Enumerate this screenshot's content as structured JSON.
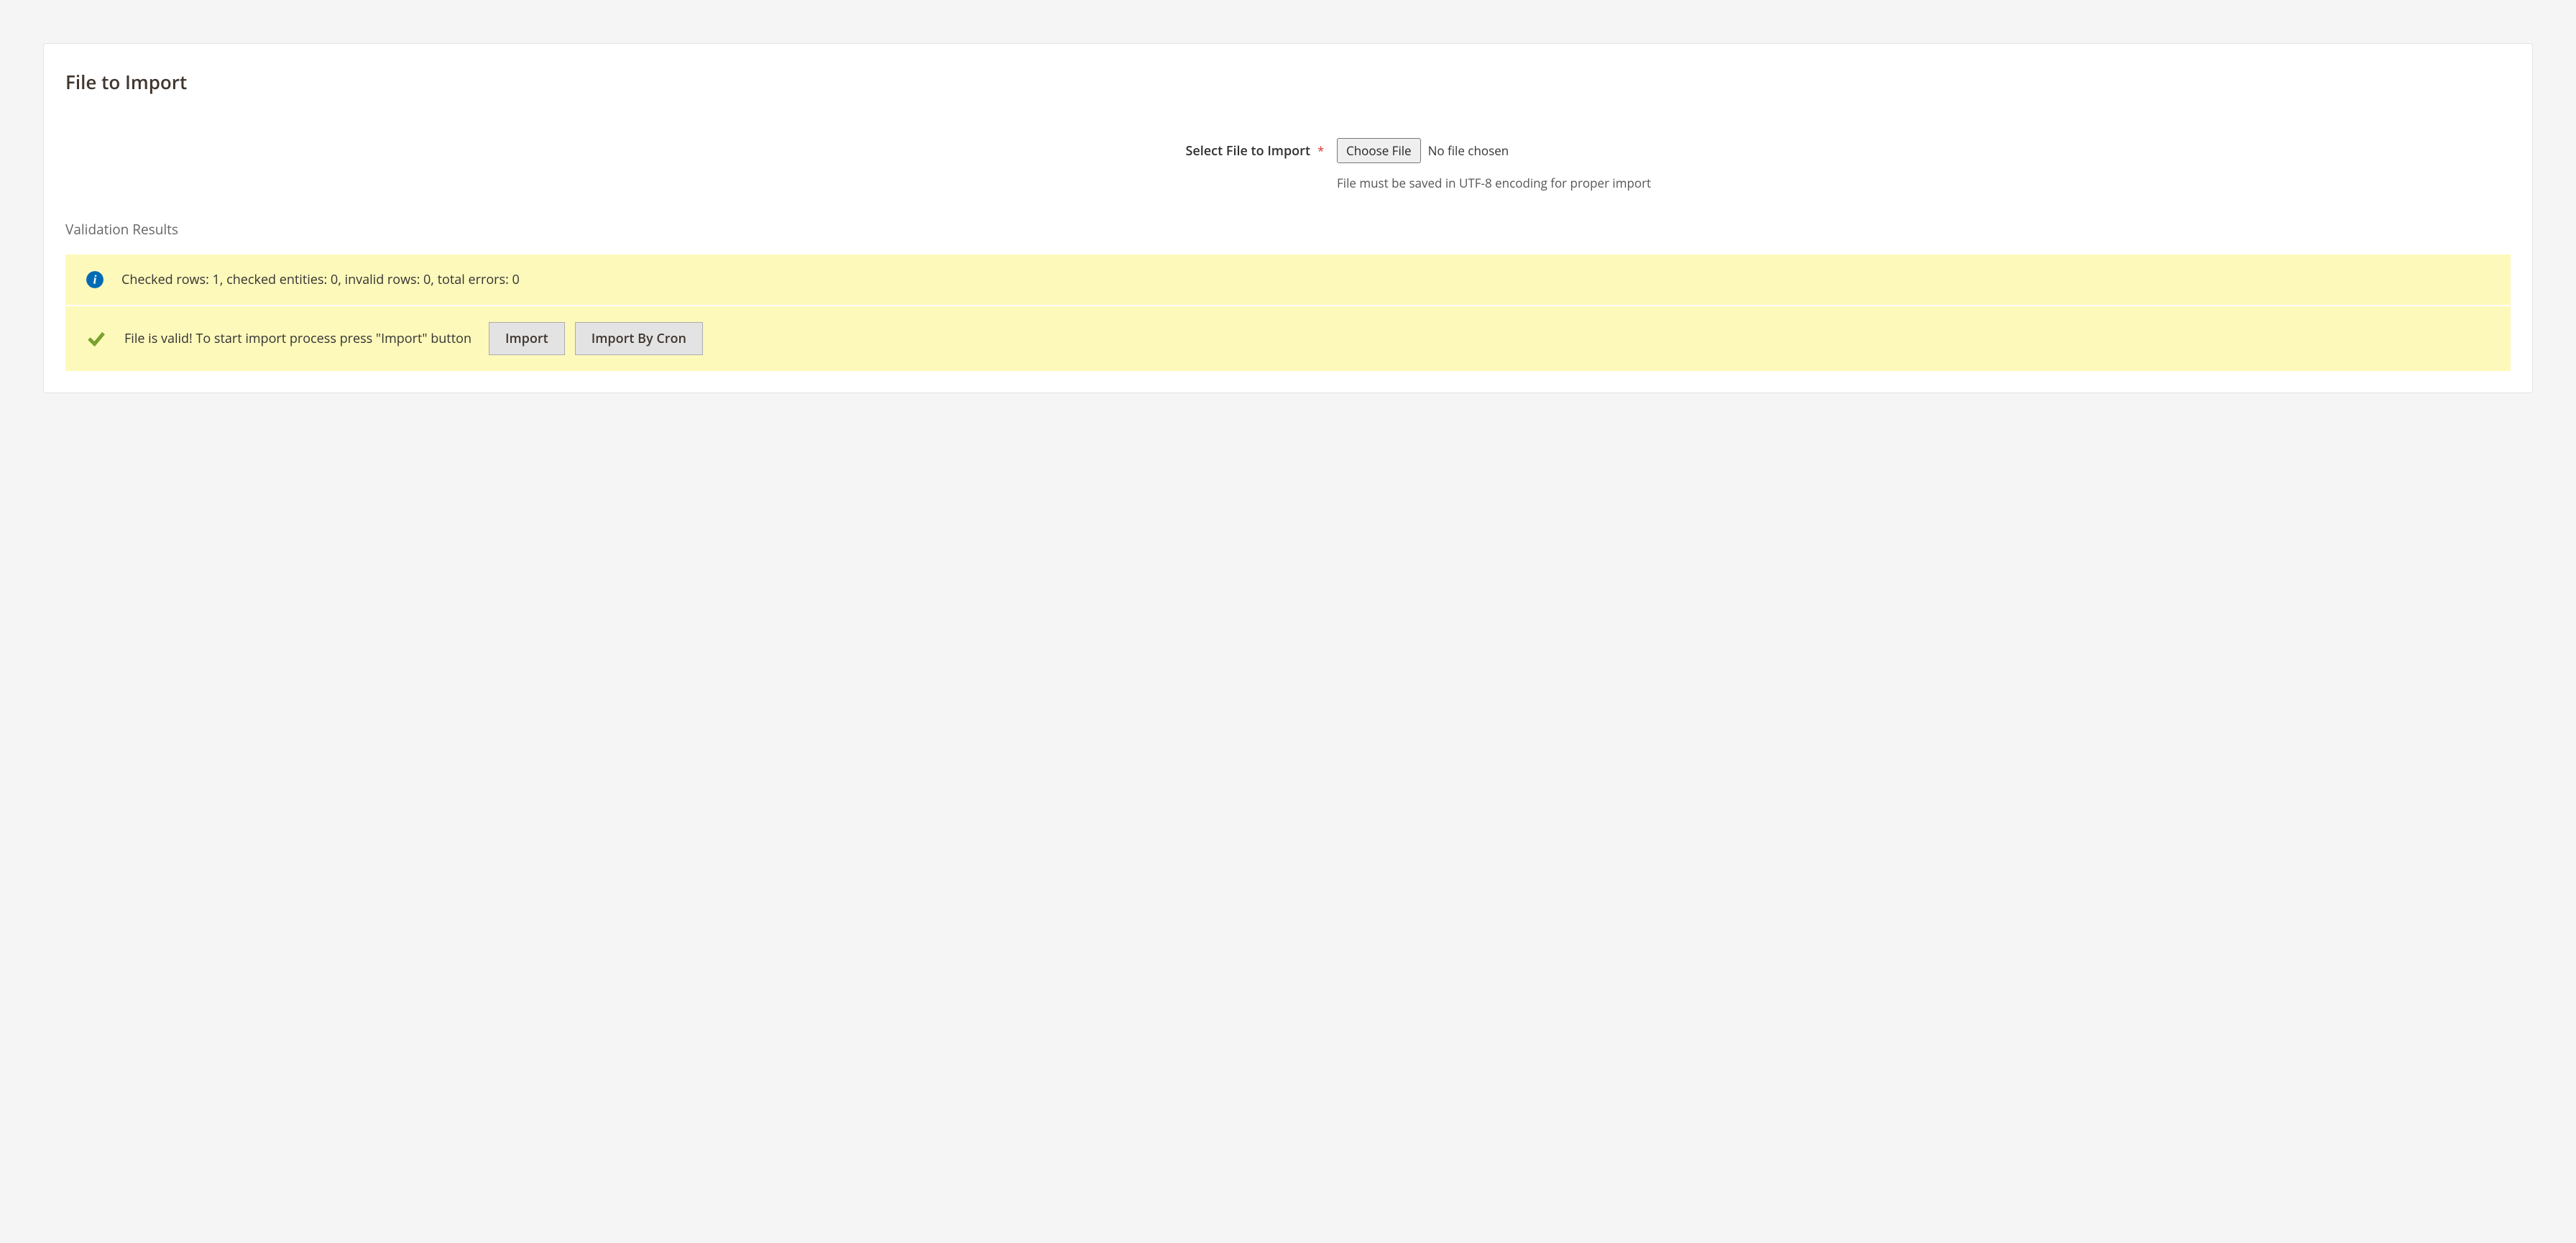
{
  "panel": {
    "title": "File to Import",
    "fileField": {
      "label": "Select File to Import",
      "requiredMark": "*",
      "chooseButton": "Choose File",
      "fileStatus": "No file chosen",
      "hint": "File must be saved in UTF-8 encoding for proper import"
    },
    "validation": {
      "heading": "Validation Results",
      "infoMessage": "Checked rows: 1, checked entities: 0, invalid rows: 0, total errors: 0",
      "successMessage": "File is valid! To start import process press \"Import\" button",
      "importButton": "Import",
      "importByCronButton": "Import By Cron"
    }
  }
}
